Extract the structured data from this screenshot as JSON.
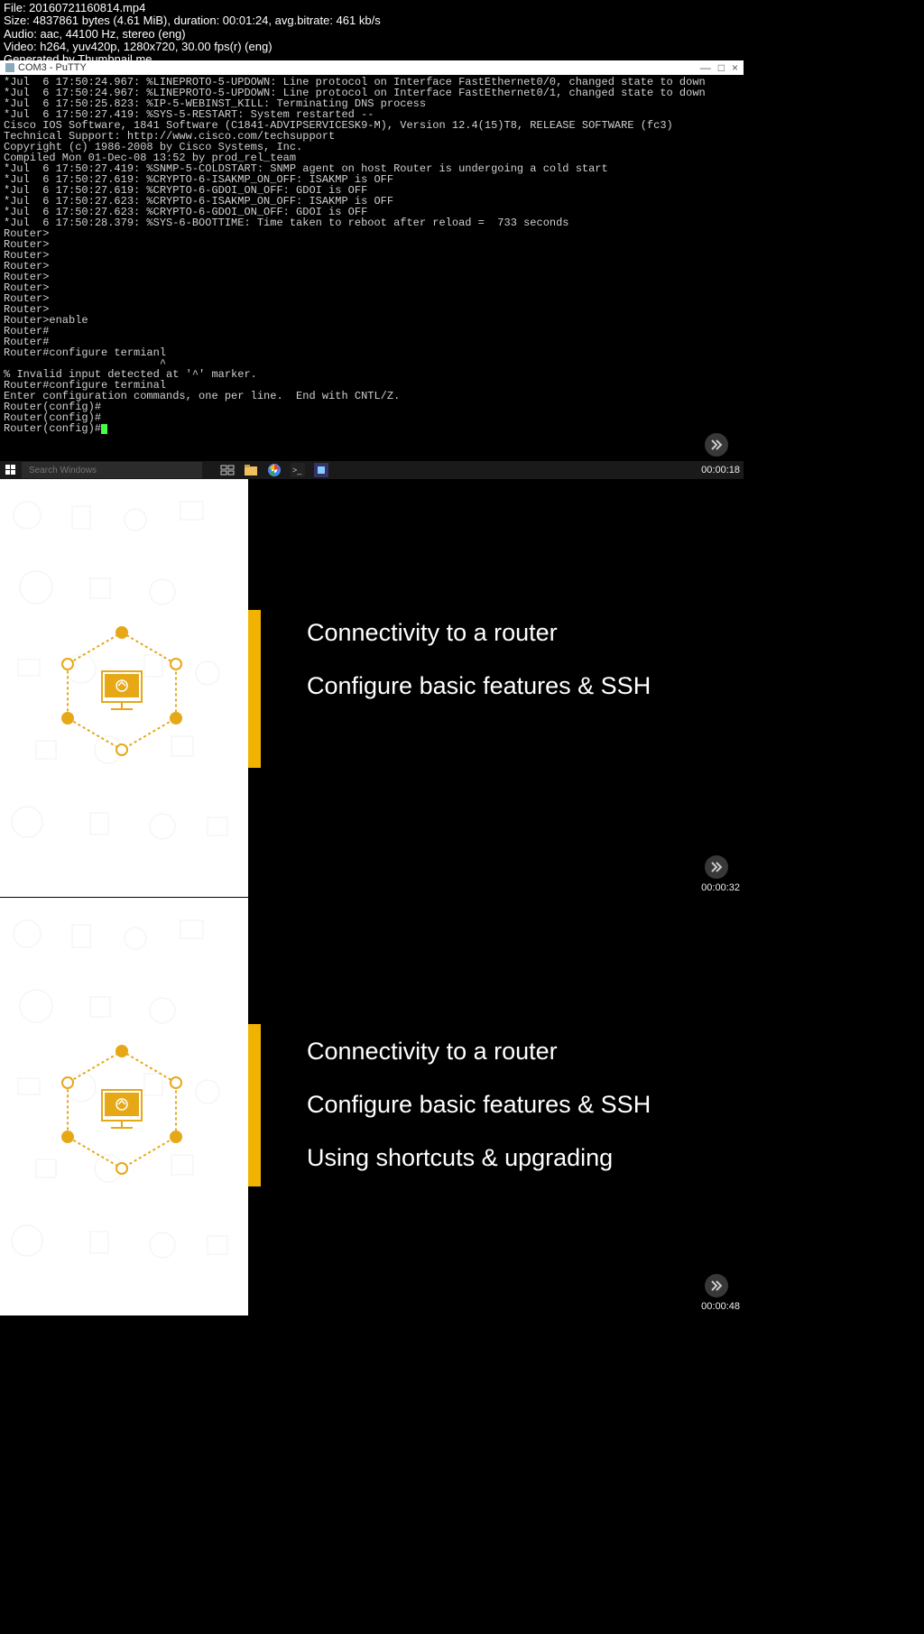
{
  "header": {
    "file": "File: 20160721160814.mp4",
    "size": "Size: 4837861 bytes (4.61 MiB), duration: 00:01:24, avg.bitrate: 461 kb/s",
    "audio": "Audio: aac, 44100 Hz, stereo (eng)",
    "video": "Video: h264, yuv420p, 1280x720, 30.00 fps(r) (eng)",
    "generated": "Generated by Thumbnail me"
  },
  "putty": {
    "title": "COM3 - PuTTY",
    "minimize": "—",
    "maximize": "□",
    "close": "×"
  },
  "terminal_lines": [
    "*Jul  6 17:50:24.967: %LINEPROTO-5-UPDOWN: Line protocol on Interface FastEthernet0/0, changed state to down",
    "*Jul  6 17:50:24.967: %LINEPROTO-5-UPDOWN: Line protocol on Interface FastEthernet0/1, changed state to down",
    "*Jul  6 17:50:25.823: %IP-5-WEBINST_KILL: Terminating DNS process",
    "*Jul  6 17:50:27.419: %SYS-5-RESTART: System restarted --",
    "Cisco IOS Software, 1841 Software (C1841-ADVIPSERVICESK9-M), Version 12.4(15)T8, RELEASE SOFTWARE (fc3)",
    "Technical Support: http://www.cisco.com/techsupport",
    "Copyright (c) 1986-2008 by Cisco Systems, Inc.",
    "Compiled Mon 01-Dec-08 13:52 by prod_rel_team",
    "*Jul  6 17:50:27.419: %SNMP-5-COLDSTART: SNMP agent on host Router is undergoing a cold start",
    "*Jul  6 17:50:27.619: %CRYPTO-6-ISAKMP_ON_OFF: ISAKMP is OFF",
    "*Jul  6 17:50:27.619: %CRYPTO-6-GDOI_ON_OFF: GDOI is OFF",
    "*Jul  6 17:50:27.623: %CRYPTO-6-ISAKMP_ON_OFF: ISAKMP is OFF",
    "*Jul  6 17:50:27.623: %CRYPTO-6-GDOI_ON_OFF: GDOI is OFF",
    "*Jul  6 17:50:28.379: %SYS-6-BOOTTIME: Time taken to reboot after reload =  733 seconds",
    "Router>",
    "Router>",
    "Router>",
    "Router>",
    "Router>",
    "Router>",
    "Router>",
    "Router>",
    "Router>enable",
    "Router#",
    "Router#",
    "Router#configure termianl",
    "                        ^",
    "% Invalid input detected at '^' marker.",
    "",
    "Router#configure terminal",
    "Enter configuration commands, one per line.  End with CNTL/Z.",
    "Router(config)#",
    "Router(config)#",
    "Router(config)#"
  ],
  "taskbar": {
    "search_placeholder": "Search Windows"
  },
  "timestamps": {
    "t1": "00:00:18",
    "t2": "00:00:32",
    "t3": "00:00:48"
  },
  "slide2": {
    "line1": "Connectivity to a router",
    "line2": "Configure basic features & SSH"
  },
  "slide3": {
    "line1": "Connectivity to a router",
    "line2": "Configure basic features & SSH",
    "line3": "Using shortcuts & upgrading"
  }
}
